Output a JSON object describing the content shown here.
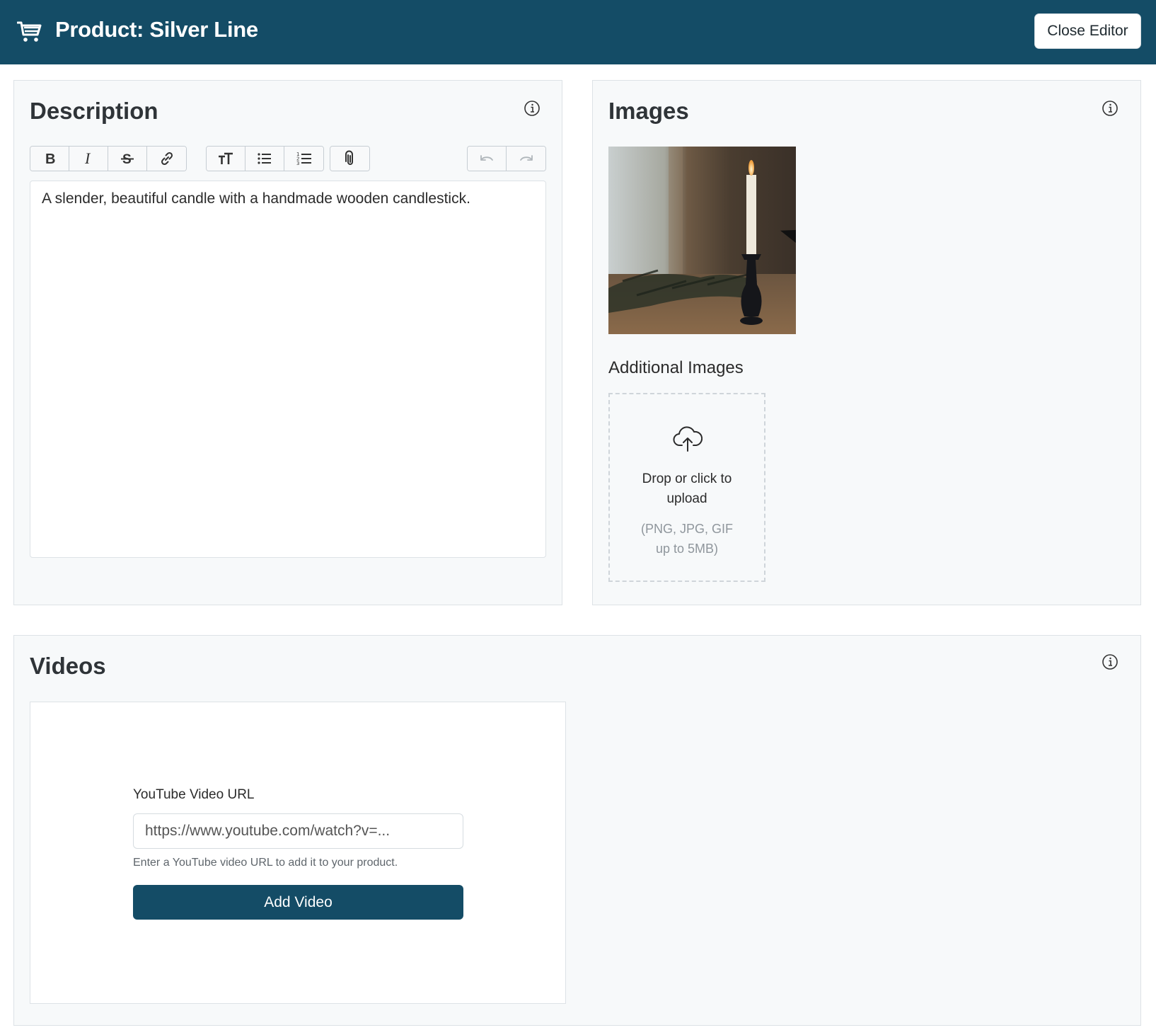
{
  "header": {
    "title": "Product: Silver Line",
    "close_label": "Close Editor",
    "icon": "cart-icon"
  },
  "description": {
    "title": "Description",
    "content": "A slender, beautiful candle with a handmade wooden candlestick.",
    "toolbar": [
      [
        "bold-icon",
        "italic-icon",
        "strikethrough-icon",
        "link-icon"
      ],
      [
        "heading-icon",
        "bullet-list-icon",
        "numbered-list-icon"
      ],
      [
        "attachment-icon"
      ],
      [
        "undo-icon",
        "redo-icon"
      ]
    ]
  },
  "images": {
    "title": "Images",
    "additional_title": "Additional Images",
    "upload_text": "Drop or click to upload",
    "upload_hint": "(PNG, JPG, GIF up to 5MB)"
  },
  "videos": {
    "title": "Videos",
    "field_label": "YouTube Video URL",
    "placeholder": "https://www.youtube.com/watch?v=...",
    "help_text": "Enter a YouTube video URL to add it to your product.",
    "add_label": "Add Video"
  },
  "colors": {
    "accent": "#144c66",
    "panel_bg": "#f7f9fa",
    "border": "#dde2e6"
  }
}
